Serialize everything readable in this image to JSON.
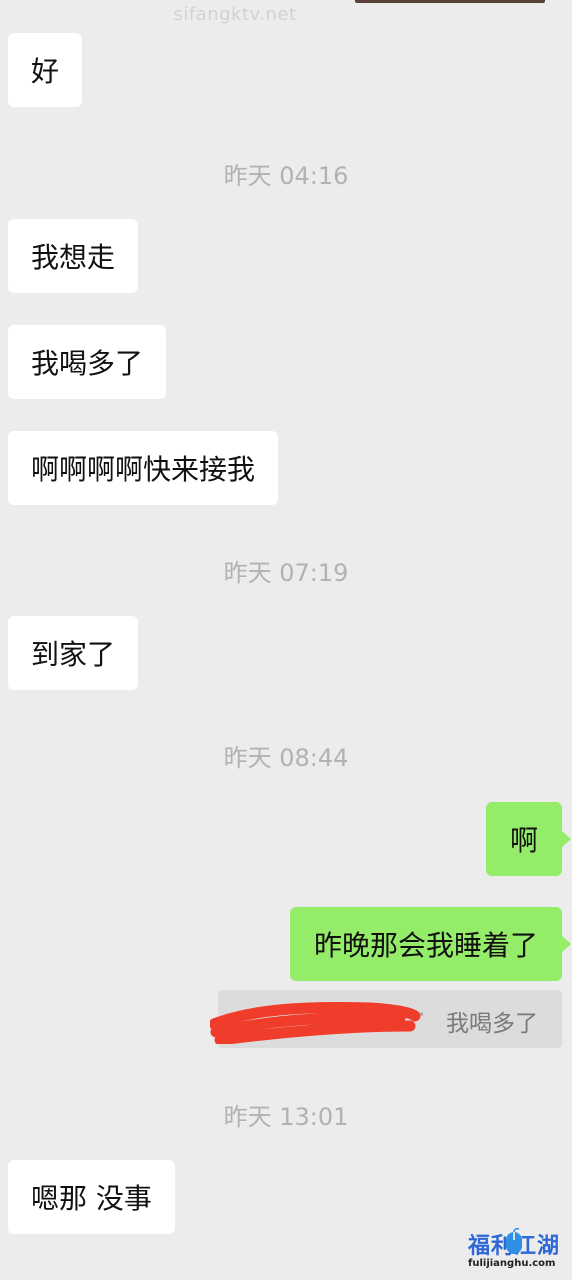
{
  "watermark": "sifangktv.net",
  "timestamps": {
    "t1": "昨天 04:16",
    "t2": "昨天 07:19",
    "t3": "昨天 08:44",
    "t4": "昨天 13:01"
  },
  "messages": [
    {
      "side": "in",
      "text": "好"
    },
    {
      "side": "in",
      "text": "我想走"
    },
    {
      "side": "in",
      "text": "我喝多了"
    },
    {
      "side": "in",
      "text": "啊啊啊啊快来接我"
    },
    {
      "side": "in",
      "text": "到家了"
    },
    {
      "side": "out",
      "text": "啊"
    },
    {
      "side": "out",
      "text": "昨晚那会我睡着了"
    },
    {
      "side": "in",
      "text": "嗯那 没事"
    }
  ],
  "quote": {
    "text": "我喝多了",
    "separator": "·"
  },
  "logo": {
    "name": "福利江湖",
    "url": "fulijianghu.com"
  },
  "colors": {
    "background": "#ececec",
    "incoming": "#ffffff",
    "outgoing": "#95ec69",
    "redaction": "#f03c2a"
  }
}
